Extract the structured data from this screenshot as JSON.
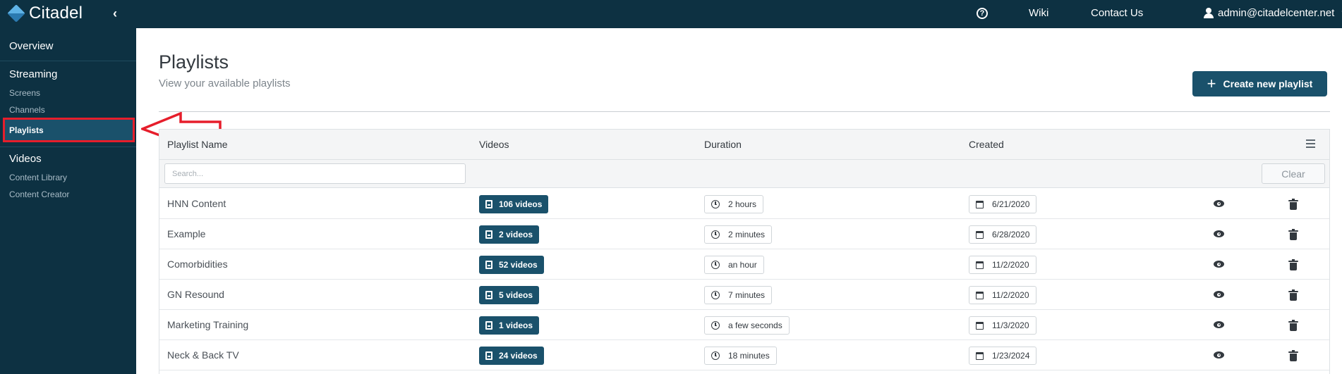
{
  "topbar": {
    "brand": "Citadel",
    "collapse_symbol": "‹",
    "help_symbol": "?",
    "nav": {
      "wiki": "Wiki",
      "contact": "Contact Us"
    },
    "user": "admin@citadelcenter.net"
  },
  "sidebar": {
    "overview": "Overview",
    "streaming_label": "Streaming",
    "streaming_items": [
      "Screens",
      "Channels",
      "Playlists"
    ],
    "videos_label": "Videos",
    "videos_items": [
      "Content Library",
      "Content Creator"
    ],
    "active_item": "Playlists"
  },
  "page": {
    "title": "Playlists",
    "subtitle": "View your available playlists",
    "create_button": "Create new playlist"
  },
  "table": {
    "columns": [
      "Playlist Name",
      "Videos",
      "Duration",
      "Created"
    ],
    "search_placeholder": "Search...",
    "clear_button": "Clear",
    "rows": [
      {
        "name": "HNN Content",
        "videos": "106 videos",
        "duration": "2 hours",
        "created": "6/21/2020"
      },
      {
        "name": "Example",
        "videos": "2 videos",
        "duration": "2 minutes",
        "created": "6/28/2020"
      },
      {
        "name": "Comorbidities",
        "videos": "52 videos",
        "duration": "an hour",
        "created": "11/2/2020"
      },
      {
        "name": "GN Resound",
        "videos": "5 videos",
        "duration": "7 minutes",
        "created": "11/2/2020"
      },
      {
        "name": "Marketing Training",
        "videos": "1 videos",
        "duration": "a few seconds",
        "created": "11/3/2020"
      },
      {
        "name": "Neck & Back TV",
        "videos": "24 videos",
        "duration": "18 minutes",
        "created": "1/23/2024"
      }
    ]
  },
  "colors": {
    "nav_bg": "#0d3142",
    "accent": "#1a516b",
    "highlight_border": "#e61e2b"
  }
}
